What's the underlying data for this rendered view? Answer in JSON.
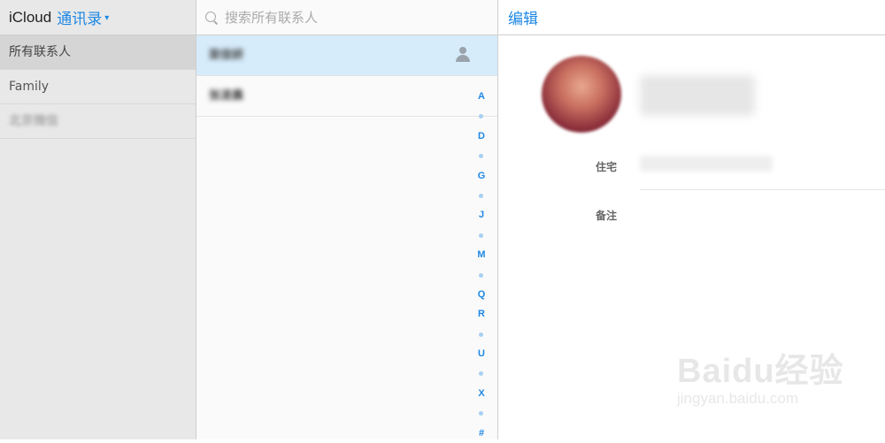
{
  "sidebar": {
    "brand": "iCloud",
    "app_name": "通讯录",
    "groups": [
      {
        "label": "所有联系人"
      },
      {
        "label": "Family"
      },
      {
        "label": "北京微信"
      }
    ]
  },
  "list": {
    "search_placeholder": "搜索所有联系人",
    "contacts": [
      {
        "name": "梁佳妍"
      },
      {
        "name": "张凌晨"
      }
    ],
    "index": [
      "A",
      "•",
      "D",
      "•",
      "G",
      "•",
      "J",
      "•",
      "M",
      "•",
      "Q",
      "R",
      "•",
      "U",
      "•",
      "X",
      "•",
      "#"
    ]
  },
  "detail": {
    "edit_label": "编辑",
    "name": "梁佳妍",
    "home_label": "住宅",
    "home_value": "1393000000@qq.com",
    "notes_label": "备注"
  },
  "watermark": {
    "logo": "Baidu经验",
    "url": "jingyan.baidu.com"
  },
  "colors": {
    "accent": "#1e88e5",
    "selected_row": "#d6ecfb",
    "sidebar_bg": "#e8e8e8"
  }
}
